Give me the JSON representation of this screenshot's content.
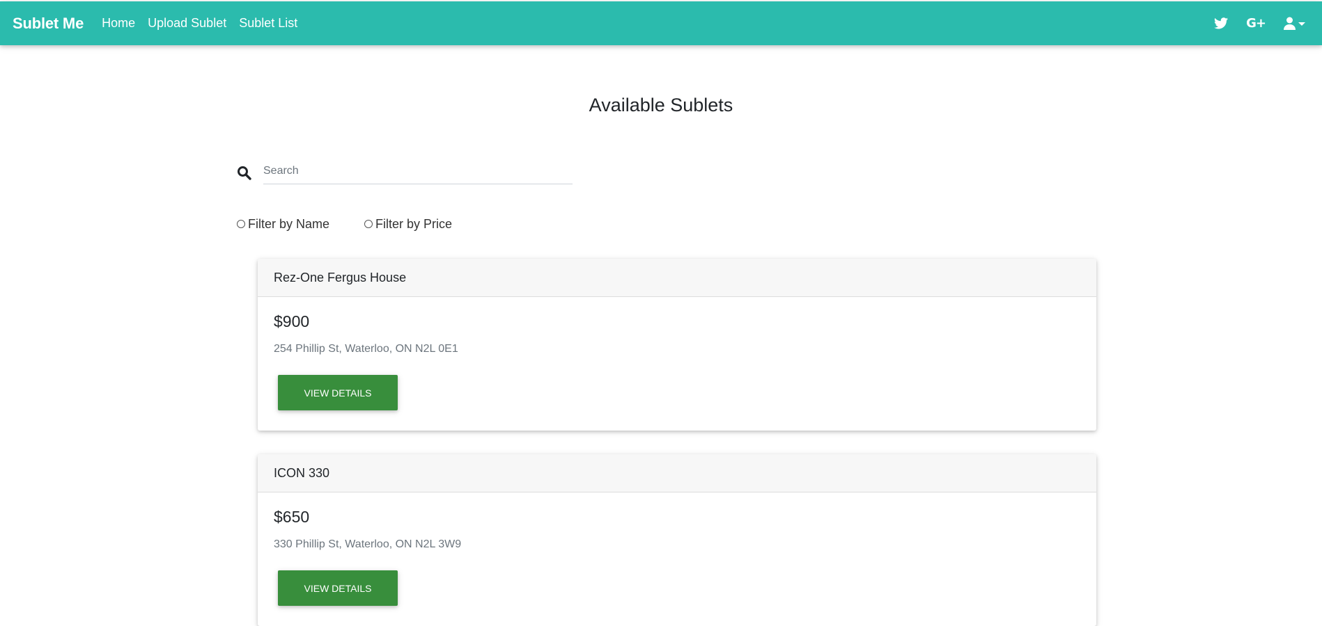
{
  "navbar": {
    "brand": "Sublet Me",
    "links": [
      "Home",
      "Upload Sublet",
      "Sublet List"
    ],
    "icons": [
      "twitter-icon",
      "google-plus-icon",
      "user-icon"
    ],
    "gplus_text": "G+",
    "color": "#2bbbad"
  },
  "main": {
    "title": "Available Sublets",
    "search": {
      "placeholder": "Search",
      "value": ""
    },
    "filters": [
      "Filter by Name",
      "Filter by Price"
    ]
  },
  "listings": [
    {
      "name": "Rez-One Fergus House",
      "price": "$900",
      "address": "254 Phillip St, Waterloo, ON N2L 0E1",
      "button_label": "VIEW DETAILS"
    },
    {
      "name": "ICON 330",
      "price": "$650",
      "address": "330 Phillip St, Waterloo, ON N2L 3W9",
      "button_label": "VIEW DETAILS"
    }
  ],
  "colors": {
    "accent": "#2bbbad",
    "button": "#388e3c"
  }
}
